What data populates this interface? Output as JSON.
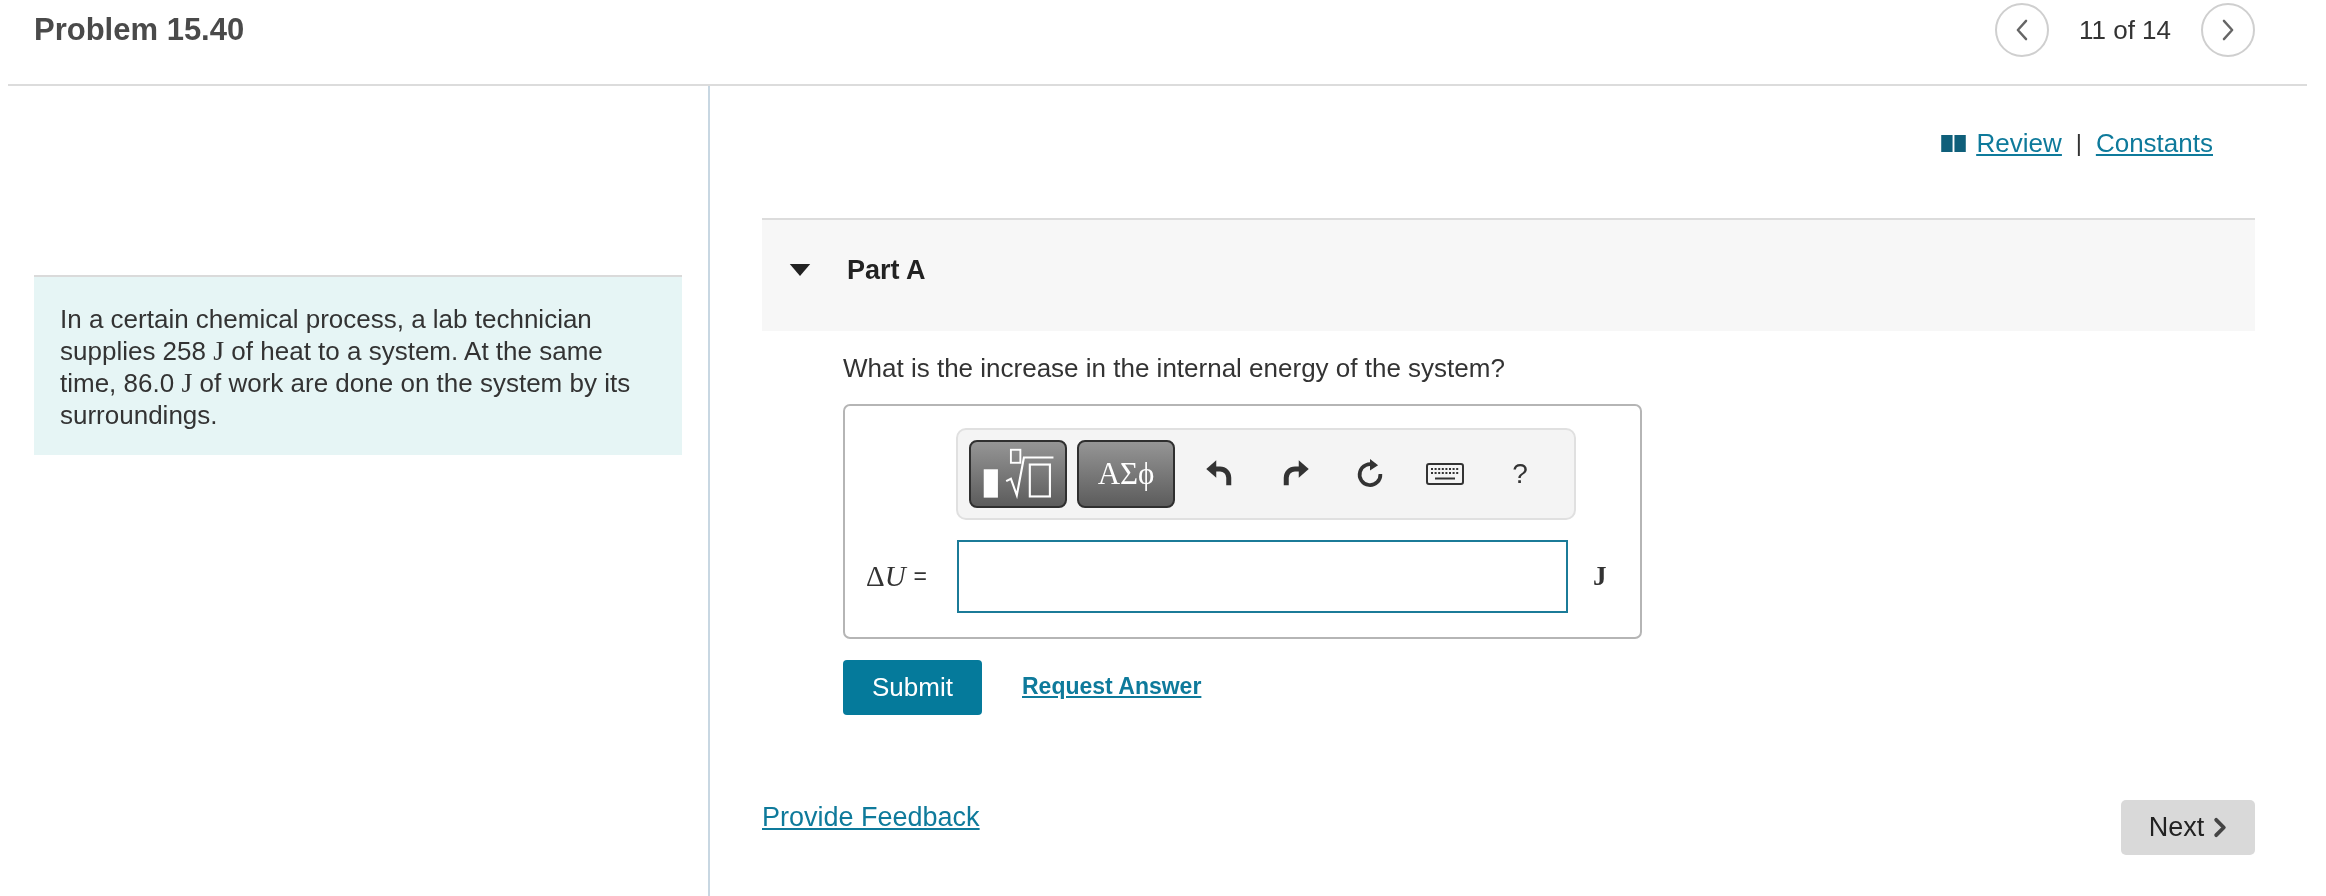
{
  "header": {
    "title": "Problem 15.40",
    "position": "11 of 14"
  },
  "problem": {
    "segments": [
      {
        "kind": "text",
        "text": "In a certain chemical process, a lab technician supplies 258 "
      },
      {
        "kind": "math",
        "text": "J"
      },
      {
        "kind": "text",
        "text": " of heat to a system. At the same time, 86.0 "
      },
      {
        "kind": "math",
        "text": "J"
      },
      {
        "kind": "text",
        "text": " of work are done on the system by its surroundings."
      }
    ]
  },
  "resources": {
    "links": [
      {
        "kind": "icon",
        "label": "Review"
      },
      {
        "kind": "text",
        "label": "Constants"
      }
    ],
    "separator": "|"
  },
  "part": {
    "label": "Part A",
    "expanded": true,
    "question": "What is the increase in the internal energy of the system?"
  },
  "toolbar": [
    {
      "kind": "templates"
    },
    {
      "kind": "symbols",
      "label": "ΑΣϕ"
    },
    {
      "kind": "undo"
    },
    {
      "kind": "redo"
    },
    {
      "kind": "reset"
    },
    {
      "kind": "keyboard"
    },
    {
      "kind": "help",
      "label": "?"
    }
  ],
  "answer": {
    "label": [
      {
        "kind": "upright",
        "text": "Δ"
      },
      {
        "kind": "italic",
        "text": "U"
      }
    ],
    "equals": "=",
    "unit": "J"
  },
  "actions": {
    "submit": "Submit",
    "request_answer": "Request Answer"
  },
  "footer": {
    "feedback": "Provide Feedback",
    "next": "Next"
  }
}
